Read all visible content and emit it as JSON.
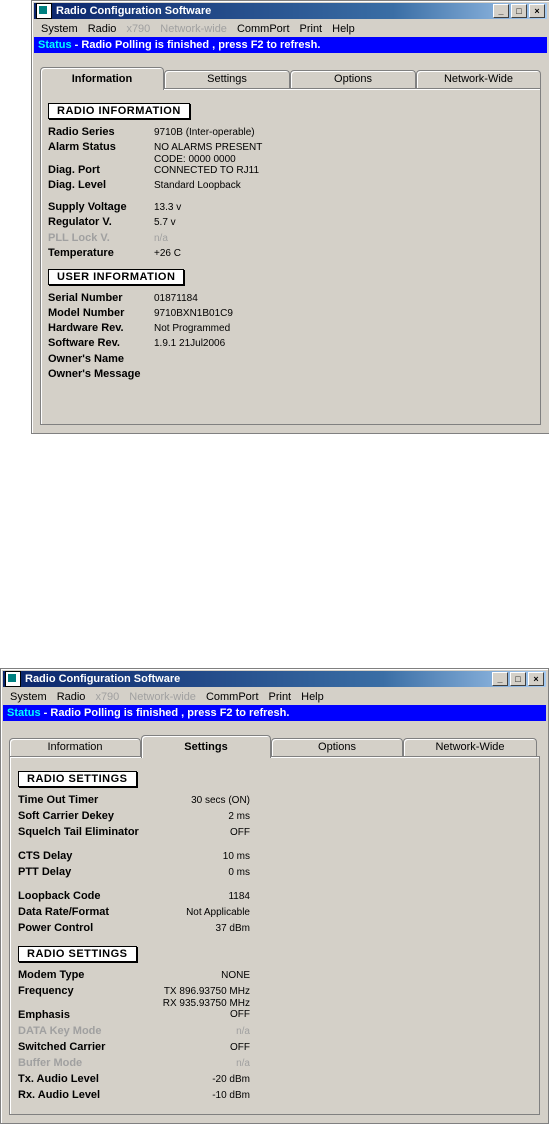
{
  "app_title": "Radio Configuration Software",
  "menu": [
    "System",
    "Radio",
    "x790",
    "Network-wide",
    "CommPort",
    "Print",
    "Help"
  ],
  "status": {
    "label": "Status",
    "message": " - Radio Polling is finished , press F2 to refresh."
  },
  "tabs": [
    "Information",
    "Settings",
    "Options",
    "Network-Wide"
  ],
  "window1": {
    "active_tab": "Information",
    "radio_info": {
      "header": "RADIO INFORMATION",
      "rows": [
        {
          "label": "Radio Series",
          "value": "9710B (Inter-operable)"
        },
        {
          "label": "Alarm Status",
          "value": "NO ALARMS PRESENT"
        },
        {
          "label": "",
          "value": "CODE: 0000 0000"
        },
        {
          "label": "Diag. Port",
          "value": "CONNECTED TO RJ11"
        },
        {
          "label": "Diag. Level",
          "value": "Standard Loopback"
        },
        {
          "label": "Supply Voltage",
          "value": "13.3 v"
        },
        {
          "label": "Regulator V.",
          "value": "5.7 v"
        },
        {
          "label": "PLL Lock V.",
          "value": "n/a"
        },
        {
          "label": "Temperature",
          "value": "+26 C"
        }
      ]
    },
    "user_info": {
      "header": "USER INFORMATION",
      "rows": [
        {
          "label": "Serial Number",
          "value": "01871184"
        },
        {
          "label": "Model Number",
          "value": "9710BXN1B01C9"
        },
        {
          "label": "Hardware Rev.",
          "value": "Not Programmed"
        },
        {
          "label": "Software  Rev.",
          "value": "1.9.1  21Jul2006"
        },
        {
          "label": "Owner's Name",
          "value": ""
        },
        {
          "label": "Owner's Message",
          "value": ""
        }
      ]
    }
  },
  "window2": {
    "active_tab": "Settings",
    "settings1": {
      "header": "RADIO SETTINGS",
      "rows": [
        {
          "label": "Time Out Timer",
          "value": "30 secs (ON)"
        },
        {
          "label": "Soft Carrier Dekey",
          "value": "2 ms"
        },
        {
          "label": "Squelch Tail Eliminator",
          "value": "OFF"
        },
        {
          "label": "CTS Delay",
          "value": "10 ms"
        },
        {
          "label": "PTT Delay",
          "value": "0 ms"
        },
        {
          "label": "Loopback Code",
          "value": "1184"
        },
        {
          "label": "Data Rate/Format",
          "value": "Not Applicable"
        },
        {
          "label": "Power Control",
          "value": "37 dBm"
        }
      ]
    },
    "settings2": {
      "header": "RADIO SETTINGS",
      "rows": [
        {
          "label": "Modem Type",
          "value": "NONE"
        },
        {
          "label": "Frequency",
          "value": "TX 896.93750 MHz"
        },
        {
          "label": "",
          "value": "RX 935.93750 MHz"
        },
        {
          "label": "Emphasis",
          "value": "OFF"
        },
        {
          "label": "DATA Key Mode",
          "value": "n/a"
        },
        {
          "label": "Switched Carrier",
          "value": "OFF"
        },
        {
          "label": "Buffer Mode",
          "value": "n/a"
        },
        {
          "label": "Tx. Audio Level",
          "value": "-20 dBm"
        },
        {
          "label": "Rx. Audio Level",
          "value": "-10 dBm"
        }
      ]
    }
  }
}
